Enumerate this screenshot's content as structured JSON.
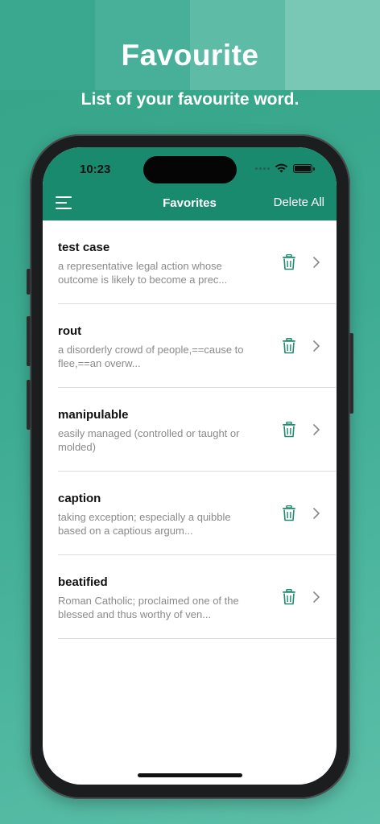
{
  "promo": {
    "title": "Favourite",
    "subtitle": "List of your favourite word."
  },
  "status_bar": {
    "time": "10:23",
    "icons": [
      "signal-dots-icon",
      "wifi-icon",
      "battery-icon"
    ]
  },
  "nav": {
    "title": "Favorites",
    "delete_all_label": "Delete All",
    "menu_icon": "hamburger-menu-icon"
  },
  "favorites": [
    {
      "word": "test case",
      "definition": "a representative legal action whose outcome is likely to become a prec..."
    },
    {
      "word": "rout",
      "definition": "a disorderly crowd of people,==cause to flee,==an overw..."
    },
    {
      "word": "manipulable",
      "definition": "easily managed (controlled or taught or molded)"
    },
    {
      "word": "caption",
      "definition": "taking exception; especially a quibble based on a captious argum..."
    },
    {
      "word": "beatified",
      "definition": "Roman Catholic; proclaimed one of the blessed and thus worthy of ven..."
    }
  ],
  "colors": {
    "primary": "#198a6e",
    "background": "#3aa88e",
    "icon_accent": "#1f8a6e",
    "text_primary": "#111111",
    "text_secondary": "#8a8a8a"
  }
}
